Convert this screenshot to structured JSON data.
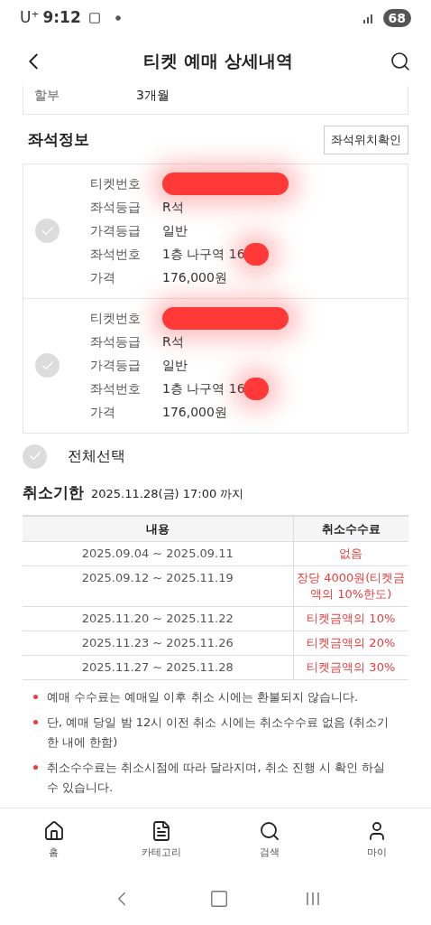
{
  "status_bar": {
    "carrier": "U⁺",
    "time": "9:12",
    "battery": "68"
  },
  "header": {
    "title": "티켓 예매 상세내역"
  },
  "payment_rows": [
    {
      "label": "할부",
      "value": "3개월"
    }
  ],
  "seat_section": {
    "title": "좌석정보",
    "button": "좌석위치확인",
    "tickets": [
      {
        "checked": false,
        "fields": [
          {
            "label": "티켓번호",
            "redacted": true
          },
          {
            "label": "좌석등급",
            "value": "R석"
          },
          {
            "label": "가격등급",
            "value": "일반"
          },
          {
            "label": "좌석번호",
            "value": "1층 나구역 16",
            "redacted": true
          },
          {
            "label": "가격",
            "value": "176,000원"
          }
        ]
      },
      {
        "checked": false,
        "fields": [
          {
            "label": "티켓번호",
            "redacted": true
          },
          {
            "label": "좌석등급",
            "value": "R석"
          },
          {
            "label": "가격등급",
            "value": "일반"
          },
          {
            "label": "좌석번호",
            "value": "1층 나구역 16",
            "redacted": true
          },
          {
            "label": "가격",
            "value": "176,000원"
          }
        ]
      }
    ],
    "select_all": {
      "label": "전체선택",
      "checked": false
    }
  },
  "cancel": {
    "title": "취소기한",
    "deadline": "2025.11.28(금) 17:00 까지",
    "table": {
      "columns": [
        "내용",
        "취소수수료"
      ],
      "rows": [
        [
          "2025.09.04 ~ 2025.09.11",
          "없음"
        ],
        [
          "2025.09.12 ~ 2025.11.19",
          "장당 4000원(티켓금액의 10%한도)"
        ],
        [
          "2025.11.20 ~ 2025.11.22",
          "티켓금액의 10%"
        ],
        [
          "2025.11.23 ~ 2025.11.26",
          "티켓금액의 20%"
        ],
        [
          "2025.11.27 ~ 2025.11.28",
          "티켓금액의 30%"
        ]
      ]
    },
    "notes": [
      "예매 수수료는 예매일 이후 취소 시에는 환불되지 않습니다.",
      "단, 예매 당일 밤 12시 이전 취소 시에는 취소수수료 없음 (취소기한 내에 한함)",
      "취소수수료는 취소시점에 따라 달라지며, 취소 진행 시 확인 하실 수 있습니다."
    ]
  },
  "bottom_nav": [
    {
      "kind": "home",
      "label": "홈"
    },
    {
      "kind": "category",
      "label": "카테고리"
    },
    {
      "kind": "search",
      "label": "검색"
    },
    {
      "kind": "my",
      "label": "마이"
    }
  ]
}
